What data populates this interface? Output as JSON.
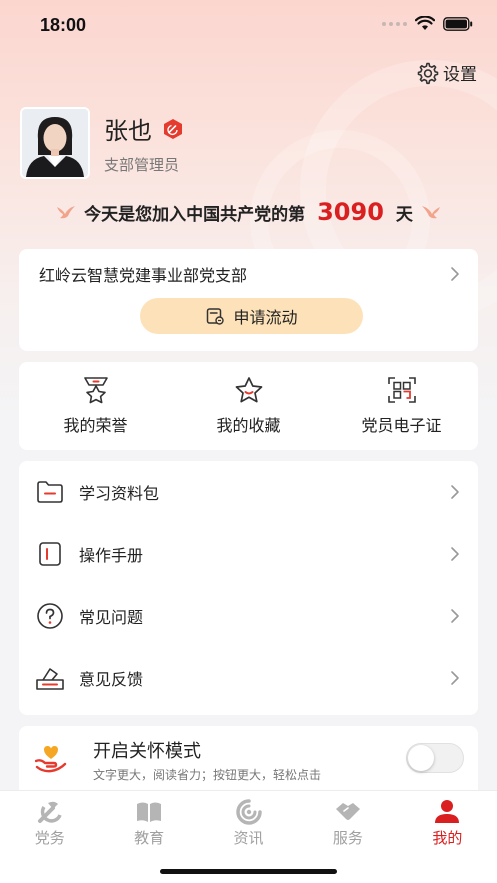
{
  "status_bar": {
    "time": "18:00"
  },
  "header": {
    "settings_label": "设置"
  },
  "profile": {
    "name": "张也",
    "role": "支部管理员"
  },
  "banner": {
    "prefix": "今天是您加入中国共产党的第",
    "days": "3090",
    "suffix": "天"
  },
  "branch": {
    "name": "红岭云智慧党建事业部党支部",
    "apply_label": "申请流动"
  },
  "quick_actions": [
    {
      "label": "我的荣誉",
      "icon": "medal-icon"
    },
    {
      "label": "我的收藏",
      "icon": "star-icon"
    },
    {
      "label": "党员电子证",
      "icon": "qr-scan-icon"
    }
  ],
  "menu": [
    {
      "label": "学习资料包",
      "icon": "folder-icon"
    },
    {
      "label": "操作手册",
      "icon": "manual-icon"
    },
    {
      "label": "常见问题",
      "icon": "question-icon"
    },
    {
      "label": "意见反馈",
      "icon": "feedback-icon"
    }
  ],
  "care_mode": {
    "title": "开启关怀模式",
    "description": "文字更大，阅读省力；按钮更大，轻松点击",
    "enabled": false
  },
  "tabs": [
    {
      "label": "党务",
      "icon": "party-emblem-icon",
      "active": false
    },
    {
      "label": "教育",
      "icon": "book-icon",
      "active": false
    },
    {
      "label": "资讯",
      "icon": "news-icon",
      "active": false
    },
    {
      "label": "服务",
      "icon": "handshake-icon",
      "active": false
    },
    {
      "label": "我的",
      "icon": "user-icon",
      "active": true
    }
  ],
  "colors": {
    "accent_red": "#d91f1f",
    "apply_button": "#fde2b9",
    "hero_bg": "#fbd6cf"
  }
}
